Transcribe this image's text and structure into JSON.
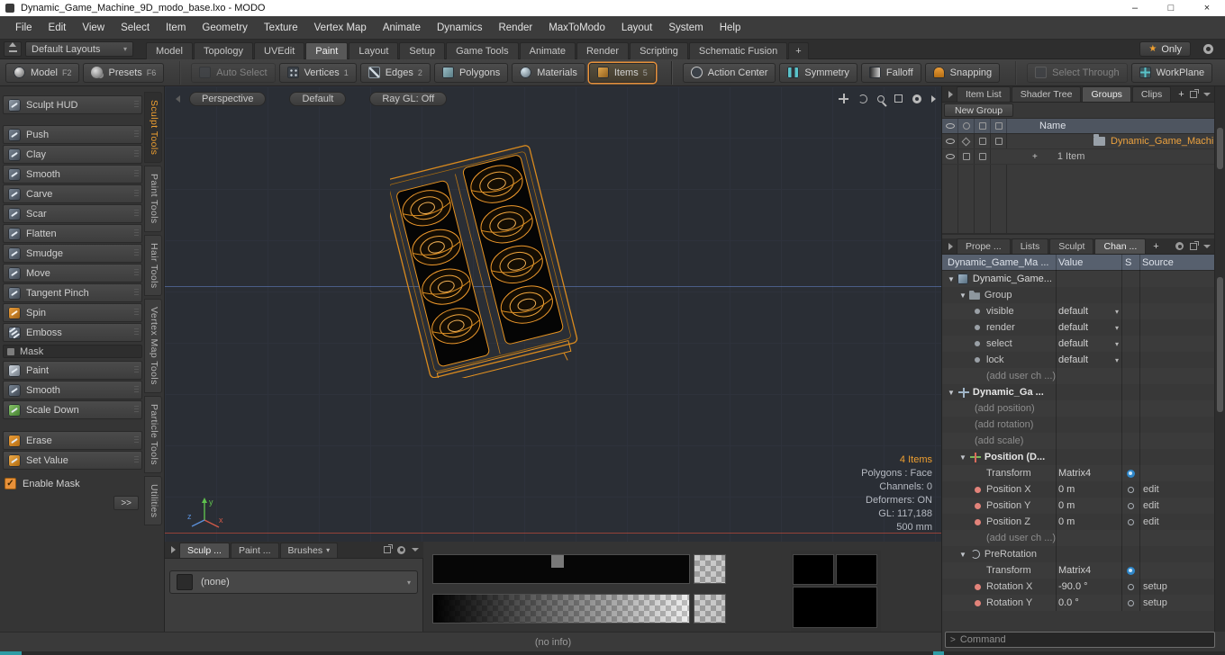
{
  "window": {
    "title": "Dynamic_Game_Machine_9D_modo_base.lxo - MODO",
    "controls": {
      "minimize": "–",
      "maximize": "□",
      "close": "×"
    }
  },
  "menu": {
    "items": [
      "File",
      "Edit",
      "View",
      "Select",
      "Item",
      "Geometry",
      "Texture",
      "Vertex Map",
      "Animate",
      "Dynamics",
      "Render",
      "MaxToModo",
      "Layout",
      "System",
      "Help"
    ]
  },
  "layout_bar": {
    "preset": "Default Layouts",
    "caret": "▾",
    "tabs": [
      {
        "label": "Model"
      },
      {
        "label": "Topology"
      },
      {
        "label": "UVEdit"
      },
      {
        "label": "Paint",
        "cls": "active"
      },
      {
        "label": "Layout"
      },
      {
        "label": "Setup"
      },
      {
        "label": "Game Tools"
      },
      {
        "label": "Animate"
      },
      {
        "label": "Render"
      },
      {
        "label": "Scripting"
      },
      {
        "label": "Schematic Fusion"
      },
      {
        "label": "+",
        "cls": "plus"
      }
    ],
    "star": "★",
    "only": "Only"
  },
  "toolbar": {
    "buttons": [
      {
        "label": "Model",
        "badge": "F2",
        "icon": "model"
      },
      {
        "label": "Presets",
        "badge": "F6",
        "icon": "presets"
      },
      {
        "label": "Auto Select",
        "icon": "auto",
        "cls": "dim gap"
      },
      {
        "label": "Vertices",
        "badge": "1",
        "icon": "vertices"
      },
      {
        "label": "Edges",
        "badge": "2",
        "icon": "edges"
      },
      {
        "label": "Polygons",
        "icon": "polygons"
      },
      {
        "label": "Materials",
        "icon": "materials"
      },
      {
        "label": "Items",
        "badge": "5",
        "icon": "items",
        "cls": "selected"
      },
      {
        "label": "Action Center",
        "icon": "action",
        "cls": "gap"
      },
      {
        "label": "Symmetry",
        "icon": "symmetry"
      },
      {
        "label": "Falloff",
        "icon": "falloff"
      },
      {
        "label": "Snapping",
        "icon": "snapping"
      },
      {
        "label": "Select Through",
        "icon": "selthrough",
        "cls": "dim gap"
      },
      {
        "label": "WorkPlane",
        "icon": "workplane"
      }
    ]
  },
  "sidebar": {
    "hud": "Sculpt HUD",
    "tools": [
      {
        "label": "Push",
        "icon": "brush"
      },
      {
        "label": "Clay",
        "icon": "brush"
      },
      {
        "label": "Smooth",
        "icon": "brush"
      },
      {
        "label": "Carve",
        "icon": "brush"
      },
      {
        "label": "Scar",
        "icon": "brush"
      },
      {
        "label": "Flatten",
        "icon": "brush"
      },
      {
        "label": "Smudge",
        "icon": "brush"
      },
      {
        "label": "Move",
        "icon": "brush"
      },
      {
        "label": "Tangent Pinch",
        "icon": "brush"
      },
      {
        "label": "Spin",
        "icon": "spin"
      },
      {
        "label": "Emboss",
        "icon": "emboss"
      }
    ],
    "mask_header": "Mask",
    "mask_tools": [
      {
        "label": "Paint",
        "icon": "paint"
      },
      {
        "label": "Smooth",
        "icon": "brush"
      },
      {
        "label": "Scale Down",
        "icon": "scaledown"
      }
    ],
    "value_tools": [
      {
        "label": "Erase",
        "icon": "erase"
      },
      {
        "label": "Set Value",
        "icon": "setvalue"
      }
    ],
    "enable_mask": "Enable Mask",
    "check": "✓",
    "more": ">>",
    "vtabs": [
      {
        "label": "Sculpt Tools",
        "cls": "active"
      },
      {
        "label": "Paint Tools"
      },
      {
        "label": "Hair Tools"
      },
      {
        "label": "Vertex Map Tools"
      },
      {
        "label": "Particle Tools"
      },
      {
        "label": "Utilities"
      }
    ]
  },
  "viewport": {
    "projection": "Perspective",
    "shading": "Default",
    "raygl": "Ray GL: Off",
    "axis": {
      "x": "x",
      "y": "y",
      "z": "z"
    },
    "stats": [
      {
        "text": "4 Items",
        "cls": "orange"
      },
      {
        "text": "Polygons : Face"
      },
      {
        "text": "Channels: 0"
      },
      {
        "text": "Deformers: ON"
      },
      {
        "text": "GL: 117,188"
      },
      {
        "text": "500 mm"
      }
    ]
  },
  "groups_panel": {
    "tabs": [
      {
        "label": "Item List"
      },
      {
        "label": "Shader Tree"
      },
      {
        "label": "Groups",
        "cls": "active"
      },
      {
        "label": "Clips"
      }
    ],
    "plus": "+",
    "new_group": "New Group",
    "name_header": "Name",
    "row": {
      "plus": "+",
      "name": "Dynamic_Game_Machine_ ...",
      "sub": "1 Item"
    }
  },
  "channels_panel": {
    "tabs": [
      {
        "label": "Prope ..."
      },
      {
        "label": "Lists"
      },
      {
        "label": "Sculpt"
      },
      {
        "label": "Chan ...",
        "cls": "active"
      }
    ],
    "plus": "+",
    "headers": {
      "name": "Dynamic_Game_Ma ...",
      "value": "Value",
      "s": "S",
      "source": "Source"
    },
    "rows": [
      {
        "indent": 0,
        "exp": "▼",
        "icon": "itemcube",
        "label": "Dynamic_Game...",
        "cls": "toprow"
      },
      {
        "indent": 1,
        "exp": "▼",
        "icon": "group",
        "label": "Group"
      },
      {
        "indent": 2,
        "icon": "chdot",
        "label": "visible",
        "value": "default",
        "dd": "▾"
      },
      {
        "indent": 2,
        "icon": "chdot",
        "label": "render",
        "value": "default",
        "dd": "▾"
      },
      {
        "indent": 2,
        "icon": "chdot",
        "label": "select",
        "value": "default",
        "dd": "▾"
      },
      {
        "indent": 2,
        "icon": "chdot",
        "label": "lock",
        "value": "default",
        "dd": "▾"
      },
      {
        "indent": 2,
        "label": "(add user ch ...)",
        "cls": "dim"
      },
      {
        "indent": 0,
        "exp": "▼",
        "icon": "xform",
        "label": "Dynamic_Ga ...",
        "cls": "bold"
      },
      {
        "indent": 1,
        "label": "(add position)",
        "cls": "dim"
      },
      {
        "indent": 1,
        "label": "(add rotation)",
        "cls": "dim"
      },
      {
        "indent": 1,
        "label": "(add scale)",
        "cls": "dim"
      },
      {
        "indent": 1,
        "exp": "▼",
        "icon": "posicon",
        "label": "Position (D...",
        "cls": "bold"
      },
      {
        "indent": 2,
        "label": "Transform",
        "value": "Matrix4",
        "sicon": "gear"
      },
      {
        "indent": 2,
        "icon": "dotx",
        "label": "Position X",
        "value": "0 m",
        "sicon": "circle",
        "source": "edit"
      },
      {
        "indent": 2,
        "icon": "doty",
        "label": "Position Y",
        "value": "0 m",
        "sicon": "circle",
        "source": "edit"
      },
      {
        "indent": 2,
        "icon": "dotz",
        "label": "Position Z",
        "value": "0 m",
        "sicon": "circle",
        "source": "edit"
      },
      {
        "indent": 2,
        "label": "(add user ch ...)",
        "cls": "dim"
      },
      {
        "indent": 1,
        "exp": "▼",
        "icon": "roticon",
        "label": "PreRotation"
      },
      {
        "indent": 2,
        "label": "Transform",
        "value": "Matrix4",
        "sicon": "gear"
      },
      {
        "indent": 2,
        "icon": "dotx",
        "label": "Rotation X",
        "value": "-90.0 °",
        "sicon": "circle",
        "source": "setup"
      },
      {
        "indent": 2,
        "icon": "doty",
        "label": "Rotation Y",
        "value": "0.0 °",
        "sicon": "circle",
        "source": "setup"
      }
    ]
  },
  "bottom": {
    "tabs": [
      {
        "label": "Sculp ...",
        "cls": "active"
      },
      {
        "label": "Paint ..."
      },
      {
        "label": "Brushes",
        "dd": "▾"
      }
    ],
    "none_label": "(none)",
    "none_caret": "▾",
    "status": "(no info)"
  },
  "command": {
    "prompt": ">",
    "placeholder": "Command"
  }
}
